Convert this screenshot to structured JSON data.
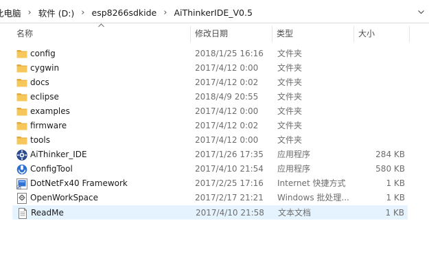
{
  "breadcrumb": {
    "items": [
      "此电脑",
      "软件 (D:)",
      "esp8266sdkide",
      "AiThinkerIDE_V0.5"
    ],
    "separator": "›"
  },
  "columns": {
    "name": "名称",
    "date": "修改日期",
    "type": "类型",
    "size": "大小"
  },
  "colors": {
    "folder": "#f6c75a",
    "folder_dark": "#e2a83b",
    "hover_row": "#e5f3ff"
  },
  "files": [
    {
      "name": "config",
      "date": "2018/1/25 16:16",
      "type": "文件夹",
      "size": "",
      "icon": "folder-icon"
    },
    {
      "name": "cygwin",
      "date": "2017/4/12 0:00",
      "type": "文件夹",
      "size": "",
      "icon": "folder-icon"
    },
    {
      "name": "docs",
      "date": "2017/4/12 0:02",
      "type": "文件夹",
      "size": "",
      "icon": "folder-icon"
    },
    {
      "name": "eclipse",
      "date": "2018/4/9 20:55",
      "type": "文件夹",
      "size": "",
      "icon": "folder-icon"
    },
    {
      "name": "examples",
      "date": "2017/4/12 0:00",
      "type": "文件夹",
      "size": "",
      "icon": "folder-icon"
    },
    {
      "name": "firmware",
      "date": "2017/4/12 0:02",
      "type": "文件夹",
      "size": "",
      "icon": "folder-icon"
    },
    {
      "name": "tools",
      "date": "2017/4/12 0:00",
      "type": "文件夹",
      "size": "",
      "icon": "folder-icon"
    },
    {
      "name": "AiThinker_IDE",
      "date": "2017/1/26 17:35",
      "type": "应用程序",
      "size": "284 KB",
      "icon": "aithinker-app-icon"
    },
    {
      "name": "ConfigTool",
      "date": "2017/4/10 21:54",
      "type": "应用程序",
      "size": "580 KB",
      "icon": "config-tool-app-icon"
    },
    {
      "name": "DotNetFx40 Framework",
      "date": "2017/2/25 17:16",
      "type": "Internet 快捷方式",
      "size": "1 KB",
      "icon": "internet-shortcut-icon"
    },
    {
      "name": "OpenWorkSpace",
      "date": "2017/2/17 21:21",
      "type": "Windows 批处理...",
      "size": "1 KB",
      "icon": "batch-file-icon"
    },
    {
      "name": "ReadMe",
      "date": "2017/4/10 21:58",
      "type": "文本文档",
      "size": "1 KB",
      "icon": "text-document-icon"
    }
  ]
}
